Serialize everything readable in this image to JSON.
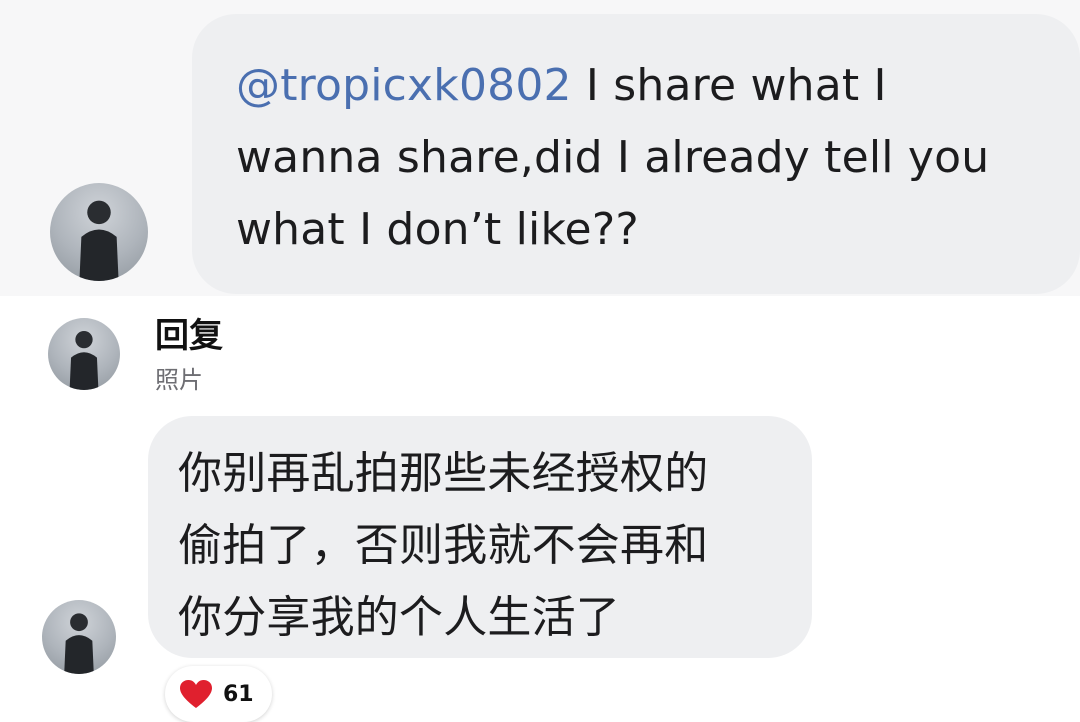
{
  "message1": {
    "mention": "@tropicxk0802",
    "text": " I share what I\nwanna share,did I already tell you\nwhat I don’t like??"
  },
  "reply_header": {
    "title": "回复",
    "subtitle": "照片"
  },
  "message2": {
    "text": "你别再乱拍那些未经授权的\n偷拍了，否则我就不会再和\n你分享我的个人生活了"
  },
  "reaction": {
    "icon": "heart-icon",
    "count": "61",
    "color": "#e0202e"
  }
}
